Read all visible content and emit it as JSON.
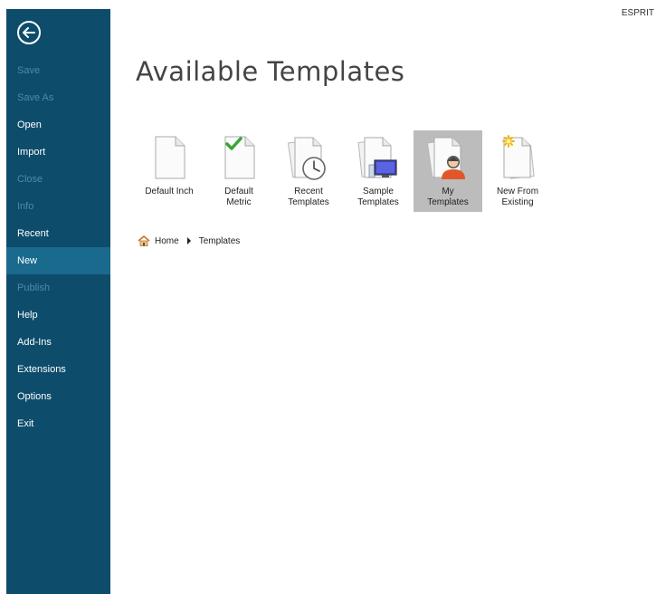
{
  "brand": "ESPRIT",
  "sidebar": {
    "items": [
      {
        "label": "Save",
        "state": "disabled"
      },
      {
        "label": "Save As",
        "state": "disabled"
      },
      {
        "label": "Open",
        "state": "enabled"
      },
      {
        "label": "Import",
        "state": "enabled"
      },
      {
        "label": "Close",
        "state": "disabled"
      },
      {
        "label": "Info",
        "state": "disabled"
      },
      {
        "label": "Recent",
        "state": "enabled"
      },
      {
        "label": "New",
        "state": "active"
      },
      {
        "label": "Publish",
        "state": "disabled"
      },
      {
        "label": "Help",
        "state": "enabled"
      },
      {
        "label": "Add-Ins",
        "state": "enabled"
      },
      {
        "label": "Extensions",
        "state": "enabled"
      },
      {
        "label": "Options",
        "state": "enabled"
      },
      {
        "label": "Exit",
        "state": "enabled"
      }
    ]
  },
  "main": {
    "title": "Available Templates",
    "tiles": [
      {
        "label": "Default Inch",
        "icon": "blank-document-icon"
      },
      {
        "label": "Default\nMetric",
        "icon": "document-checkmark-icon"
      },
      {
        "label": "Recent\nTemplates",
        "icon": "document-clock-icon"
      },
      {
        "label": "Sample\nTemplates",
        "icon": "document-monitor-icon"
      },
      {
        "label": "My\nTemplates",
        "icon": "document-user-icon",
        "selected": true
      },
      {
        "label": "New From\nExisting",
        "icon": "document-new-star-icon"
      }
    ],
    "breadcrumb": {
      "home": "Home",
      "current": "Templates"
    }
  },
  "colors": {
    "sidebar": "#0d4d6b",
    "sidebar_active": "#1a6a8e",
    "sidebar_disabled_text": "#4f8aa6",
    "tile_selected": "#bcbcbc"
  }
}
